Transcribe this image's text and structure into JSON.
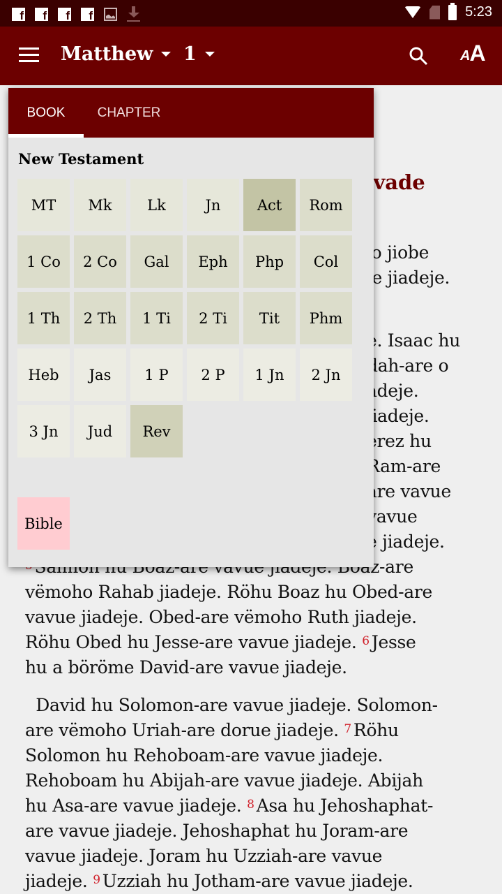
{
  "status_bar": {
    "icons_left": [
      "facebook-icon",
      "facebook-icon",
      "facebook-icon",
      "facebook-icon",
      "image-icon",
      "download-icon"
    ],
    "icons_right": [
      "wifi-icon",
      "no-sim-icon",
      "battery-icon"
    ],
    "time": "5:23"
  },
  "app_bar": {
    "menu_icon": "hamburger-menu-icon",
    "book": "Matthew",
    "chapter": "1",
    "search_icon": "search-icon",
    "font_size_icon": "text-size-icon",
    "font_icon_small": "A",
    "font_icon_big": "A",
    "color": "#6c0000"
  },
  "reader": {
    "heading_fragment": "ovade",
    "lines": [
      {
        "text": "'o jiobe"
      },
      {
        "text": "je jiadeje."
      },
      {
        "text": "e. Isaac hu"
      },
      {
        "text": "dah-are o"
      },
      {
        "text": "adeje."
      },
      {
        "text": "jiadeje."
      },
      {
        "text": "erez hu"
      },
      {
        "text": "Ram-are"
      },
      {
        "text": "are vavue"
      },
      {
        "text": "vavue"
      },
      {
        "text": "e jiadeje."
      }
    ],
    "para1": [
      {
        "verse": "5",
        "text": "Salmon hu Boaz-are vavue jiadeje. Boaz-are"
      },
      {
        "text": "vëmoho Rahab jiadeje. Röhu Boaz hu Obed-are"
      },
      {
        "text": "vavue jiadeje. Obed-are vëmoho Ruth jiadeje."
      },
      {
        "text": "Röhu Obed hu Jesse-are vavue jiadeje. ",
        "verse_after": "6",
        "after": "Jesse"
      },
      {
        "text": "hu a böröme David-are vavue jiadeje."
      }
    ],
    "para2": [
      {
        "text": "  David hu Solomon-are vavue jiadeje. Solomon-"
      },
      {
        "text": "are vëmoho Uriah-are dorue jiadeje. ",
        "verse_after": "7",
        "after": "Röhu"
      },
      {
        "text": "Solomon hu Rehoboam-are vavue jiadeje."
      },
      {
        "text": "Rehoboam hu Abijah-are vavue jiadeje. Abijah"
      },
      {
        "text": "hu Asa-are vavue jiadeje. ",
        "verse_after": "8",
        "after": "Asa hu Jehoshaphat-"
      },
      {
        "text": "are vavue jiadeje. Jehoshaphat hu Joram-are"
      },
      {
        "text": "vavue jiadeje. Joram hu Uzziah-are vavue"
      },
      {
        "text": "jiadeje. ",
        "verse_after": "9",
        "after": "Uzziah hu Jotham-are vavue jiadeje."
      }
    ]
  },
  "picker": {
    "tabs": [
      {
        "label": "BOOK",
        "active": true
      },
      {
        "label": "CHAPTER",
        "active": false
      }
    ],
    "section_label": "New Testament",
    "books": [
      {
        "label": "MT",
        "color": "#e6e7da"
      },
      {
        "label": "Mk",
        "color": "#e6e7da"
      },
      {
        "label": "Lk",
        "color": "#e6e7da"
      },
      {
        "label": "Jn",
        "color": "#e6e7da"
      },
      {
        "label": "Act",
        "color": "#c3c4a5"
      },
      {
        "label": "Rom",
        "color": "#dcddcb"
      },
      {
        "label": "1 Co",
        "color": "#dcddcb"
      },
      {
        "label": "2 Co",
        "color": "#dcddcb"
      },
      {
        "label": "Gal",
        "color": "#dcddcb"
      },
      {
        "label": "Eph",
        "color": "#dcddcb"
      },
      {
        "label": "Php",
        "color": "#dcddcb"
      },
      {
        "label": "Col",
        "color": "#dcddcb"
      },
      {
        "label": "1 Th",
        "color": "#dcddcb"
      },
      {
        "label": "2 Th",
        "color": "#dcddcb"
      },
      {
        "label": "1 Ti",
        "color": "#dcddcb"
      },
      {
        "label": "2 Ti",
        "color": "#dcddcb"
      },
      {
        "label": "Tit",
        "color": "#dcddcb"
      },
      {
        "label": "Phm",
        "color": "#dcddcb"
      },
      {
        "label": "Heb",
        "color": "#ecece3"
      },
      {
        "label": "Jas",
        "color": "#ecece3"
      },
      {
        "label": "1 P",
        "color": "#ecece3"
      },
      {
        "label": "2 P",
        "color": "#ecece3"
      },
      {
        "label": "1 Jn",
        "color": "#ecece3"
      },
      {
        "label": "2 Jn",
        "color": "#ecece3"
      },
      {
        "label": "3 Jn",
        "color": "#ecece3"
      },
      {
        "label": "Jud",
        "color": "#ecece3"
      },
      {
        "label": "Rev",
        "color": "#d0d1b8"
      }
    ],
    "bible_button": {
      "label": "Bible",
      "color": "#ffccd1"
    }
  }
}
